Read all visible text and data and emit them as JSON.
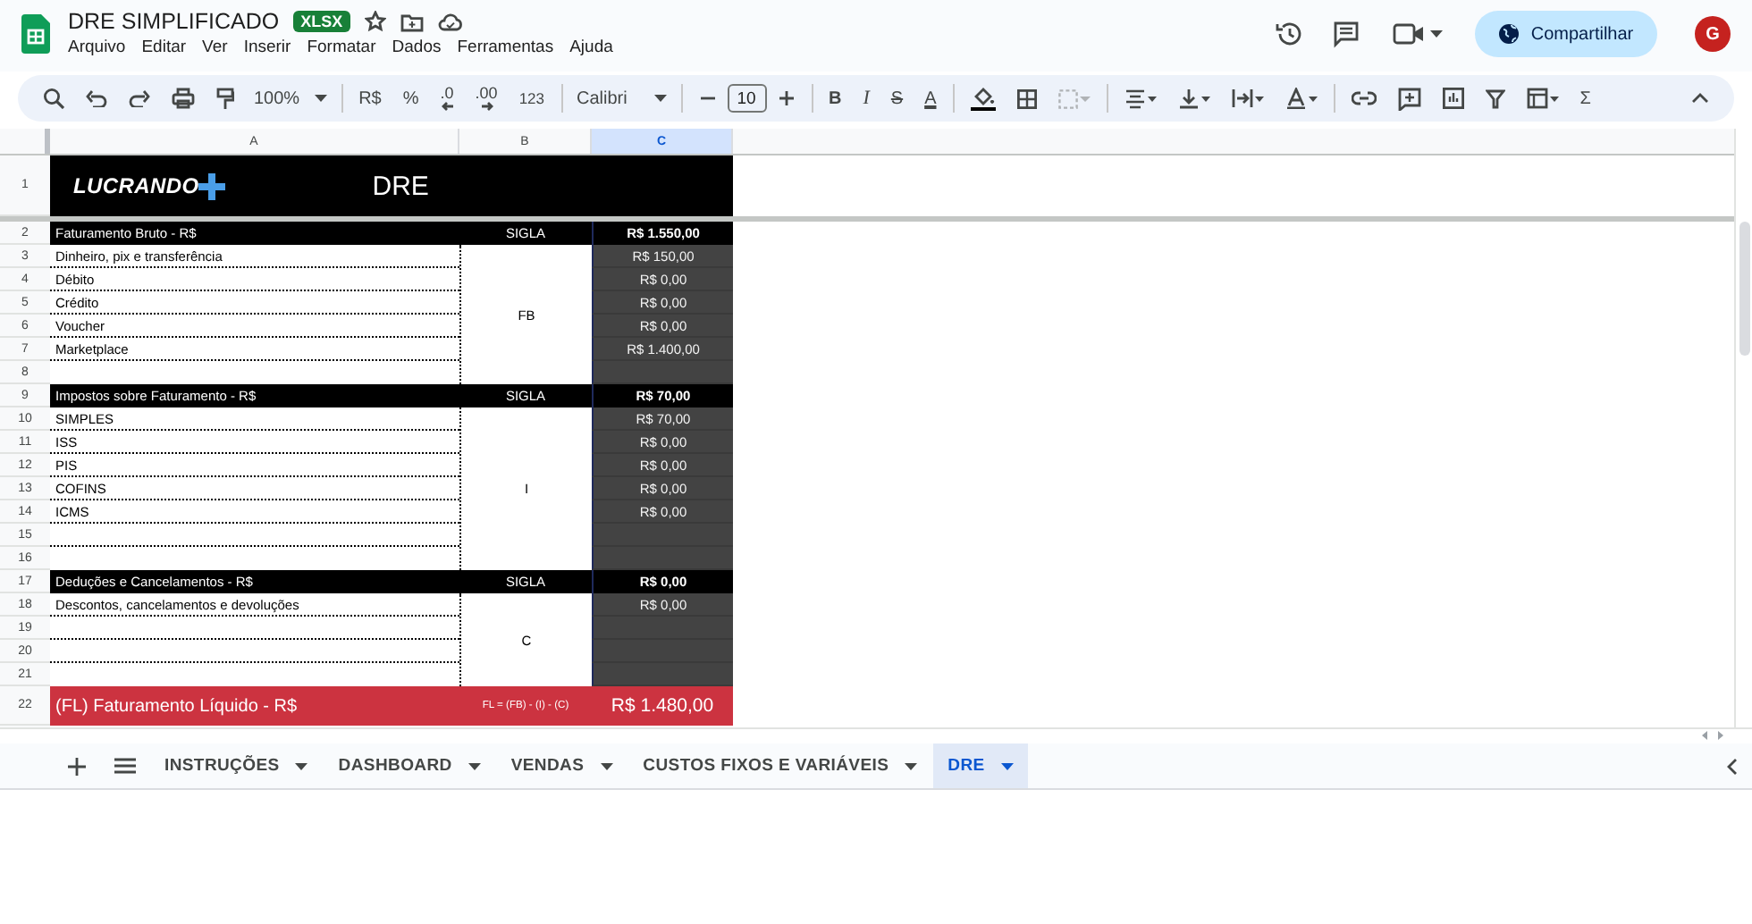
{
  "document": {
    "title": "DRE SIMPLIFICADO",
    "badge": "XLSX"
  },
  "menu": [
    "Arquivo",
    "Editar",
    "Ver",
    "Inserir",
    "Formatar",
    "Dados",
    "Ferramentas",
    "Ajuda"
  ],
  "share_button": "Compartilhar",
  "avatar": "G",
  "toolbar": {
    "zoom": "100%",
    "currency": "R$",
    "percent": "%",
    "decrease_decimals": ".0",
    "increase_decimals": ".00",
    "number_format": "123",
    "font": "Calibri",
    "font_size": "10",
    "bold": "B",
    "italic": "I",
    "strikethrough": "S",
    "text_color": "A",
    "sum": "Σ"
  },
  "columns": [
    {
      "label": "A",
      "selected": false
    },
    {
      "label": "B",
      "selected": false
    },
    {
      "label": "C",
      "selected": true
    }
  ],
  "blocks": [
    {
      "kind": "banner",
      "number": "1",
      "brand": "LUCRANDO",
      "title": "DRE"
    },
    {
      "kind": "section",
      "number": "2",
      "label": "Faturamento Bruto - R$",
      "code_label": "SIGLA",
      "total": "R$ 1.550,00",
      "code": "FB",
      "rows": [
        {
          "number": "3",
          "label": "Dinheiro, pix e transferência",
          "value": "R$ 150,00"
        },
        {
          "number": "4",
          "label": "Débito",
          "value": "R$ 0,00"
        },
        {
          "number": "5",
          "label": "Crédito",
          "value": "R$ 0,00"
        },
        {
          "number": "6",
          "label": "Voucher",
          "value": "R$ 0,00"
        },
        {
          "number": "7",
          "label": "Marketplace",
          "value": "R$ 1.400,00"
        },
        {
          "number": "8"
        }
      ]
    },
    {
      "kind": "section",
      "number": "9",
      "label": "Impostos sobre Faturamento - R$",
      "code_label": "SIGLA",
      "total": "R$ 70,00",
      "code": "I",
      "rows": [
        {
          "number": "10",
          "label": "SIMPLES",
          "value": "R$ 70,00"
        },
        {
          "number": "11",
          "label": "ISS",
          "value": "R$ 0,00"
        },
        {
          "number": "12",
          "label": "PIS",
          "value": "R$ 0,00"
        },
        {
          "number": "13",
          "label": "COFINS",
          "value": "R$ 0,00"
        },
        {
          "number": "14",
          "label": "ICMS",
          "value": "R$ 0,00"
        },
        {
          "number": "15"
        },
        {
          "number": "16"
        }
      ]
    },
    {
      "kind": "section",
      "number": "17",
      "label": "Deduções e Cancelamentos - R$",
      "code_label": "SIGLA",
      "total": "R$ 0,00",
      "code": "C",
      "rows": [
        {
          "number": "18",
          "label": "Descontos, cancelamentos e devoluções",
          "value": "R$ 0,00"
        },
        {
          "number": "19"
        },
        {
          "number": "20"
        },
        {
          "number": "21"
        }
      ]
    },
    {
      "kind": "result",
      "number": "22",
      "label": "(FL) Faturamento Líquido - R$",
      "formula": "FL = (FB) - (I) - (C)",
      "total": "R$ 1.480,00"
    }
  ],
  "sheet_tabs": [
    {
      "label": "INSTRUÇÕES",
      "selected": false
    },
    {
      "label": "DASHBOARD",
      "selected": false
    },
    {
      "label": "VENDAS",
      "selected": false
    },
    {
      "label": "CUSTOS FIXOS E VARIÁVEIS",
      "selected": false
    },
    {
      "label": "DRE",
      "selected": true
    }
  ]
}
